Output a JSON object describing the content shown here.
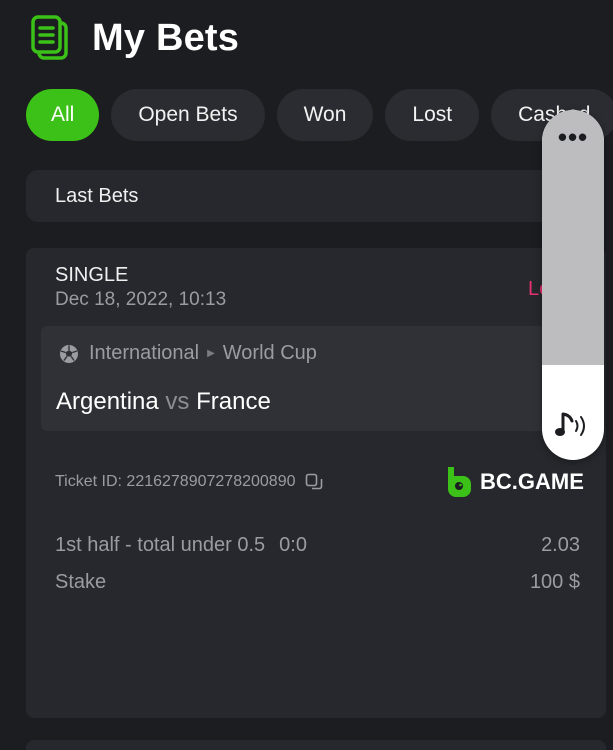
{
  "header": {
    "title": "My Bets",
    "icon": "bets-list-icon"
  },
  "tabs": [
    {
      "label": "All",
      "active": true
    },
    {
      "label": "Open Bets",
      "active": false
    },
    {
      "label": "Won",
      "active": false
    },
    {
      "label": "Lost",
      "active": false
    },
    {
      "label": "Cashed",
      "active": false
    }
  ],
  "section": {
    "title": "Last Bets"
  },
  "bet": {
    "type": "SINGLE",
    "date": "Dec 18, 2022, 10:13",
    "status": "Lost",
    "league": {
      "region": "International",
      "competition": "World Cup"
    },
    "home_team": "Argentina",
    "vs": "vs",
    "away_team": "France",
    "ticket_label": "Ticket ID: 2216278907278200890",
    "brand": "BC.GAME",
    "selection": "1st half - total under 0.5",
    "score": "0:0",
    "odds": "2.03",
    "stake_label": "Stake",
    "stake_value": "100 $"
  },
  "overlay": {
    "menu": "•••",
    "icon": "music-note-icon"
  },
  "colors": {
    "accent": "#3bc117",
    "lost": "#e8326d",
    "background": "#1c1d21",
    "card": "#26282d"
  }
}
